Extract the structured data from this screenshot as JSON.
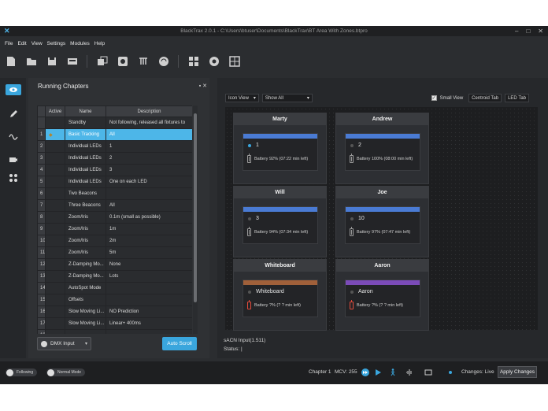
{
  "app": {
    "window_title": "BlackTrax 2.0.1 - C:\\Users\\btuser\\Documents\\BlackTrax\\BT Area With Zones.btpro"
  },
  "menu": [
    "File",
    "Edit",
    "View",
    "Settings",
    "Modules",
    "Help"
  ],
  "toolbar_icons": [
    "new-file-icon",
    "open-folder-icon",
    "save-icon",
    "save-as-icon",
    "clone-icon",
    "sync-icon",
    "trackers-icon",
    "wifi-icon",
    "layout-icon",
    "target-icon",
    "grid-icon"
  ],
  "rail_icons": [
    "eye-icon",
    "pencil-icon",
    "wave-icon",
    "camera-icon",
    "network-icon"
  ],
  "chapters": {
    "title": "Running Chapters",
    "columns": {
      "active": "Active",
      "name": "Name",
      "description": "Description"
    },
    "rows": [
      {
        "num": "",
        "name": "Standby",
        "description": "Not following, released all fixtures to"
      },
      {
        "num": "1",
        "name": "Basic Tracking",
        "description": "All",
        "selected": true
      },
      {
        "num": "2",
        "name": "Individual LEDs",
        "description": "1"
      },
      {
        "num": "3",
        "name": "Individual LEDs",
        "description": "2"
      },
      {
        "num": "4",
        "name": "Individual LEDs",
        "description": "3"
      },
      {
        "num": "5",
        "name": "Individual LEDs",
        "description": "One on each LED"
      },
      {
        "num": "6",
        "name": "Two Beacons",
        "description": ""
      },
      {
        "num": "7",
        "name": "Three Beacons",
        "description": "All"
      },
      {
        "num": "8",
        "name": "Zoom/Iris",
        "description": "0.1m (small as possible)"
      },
      {
        "num": "9",
        "name": "Zoom/Iris",
        "description": "1m"
      },
      {
        "num": "10",
        "name": "Zoom/Iris",
        "description": "2m"
      },
      {
        "num": "11",
        "name": "Zoom/Iris",
        "description": "5m"
      },
      {
        "num": "12",
        "name": "Z-Damping Mo...",
        "description": "None"
      },
      {
        "num": "13",
        "name": "Z-Damping Mo...",
        "description": "Lots"
      },
      {
        "num": "14",
        "name": "AutoSpot Mode",
        "description": ""
      },
      {
        "num": "15",
        "name": "Offsets",
        "description": ""
      },
      {
        "num": "16",
        "name": "Slow Moving Li...",
        "description": "NO Prediction"
      },
      {
        "num": "17",
        "name": "Slow Moving Li...",
        "description": "Linear+ 400ms"
      },
      {
        "num": "18",
        "name": "",
        "description": ""
      }
    ],
    "input_select": "DMX Input",
    "auto_scroll": "Auto Scroll"
  },
  "view": {
    "view_mode": "Icon View",
    "filter": "Show All",
    "small_view_label": "Small View",
    "small_view_checked": true,
    "centroid_tab": "Centroid Tab",
    "led_tab": "LED Tab"
  },
  "trackers": [
    {
      "name": "Marty",
      "id": "1",
      "battery": "Battery 92% (07:22 min left)",
      "level": 0.92,
      "color": "#4a7bd4",
      "low": false,
      "active": true
    },
    {
      "name": "Andrew",
      "id": "2",
      "battery": "Battery 100% (08:00 min left)",
      "level": 1.0,
      "color": "#4a7bd4",
      "low": false,
      "active": false
    },
    {
      "name": "Will",
      "id": "3",
      "battery": "Battery 94% (07:34 min left)",
      "level": 0.94,
      "color": "#4a7bd4",
      "low": false,
      "active": false
    },
    {
      "name": "Joe",
      "id": "10",
      "battery": "Battery 97% (07:47 min left)",
      "level": 0.97,
      "color": "#4a7bd4",
      "low": false,
      "active": false
    },
    {
      "name": "Whiteboard",
      "id": "Whiteboard",
      "battery": "Battery ?% (? ? min left)",
      "level": 0.0,
      "color": "#a0603a",
      "low": true,
      "active": false
    },
    {
      "name": "Aaron",
      "id": "Aaron",
      "battery": "Battery ?% (? ? min left)",
      "level": 0.0,
      "color": "#7b4bb8",
      "low": true,
      "active": false
    }
  ],
  "info": {
    "sacn": "sACN Input(1.511)",
    "status": "Status: |"
  },
  "bottom": {
    "following": "Following",
    "normal_mode": "Normal Mode",
    "chapter": "Chapter 1",
    "mcv": "MCV: 255",
    "changes": "Changes: Live",
    "apply": "Apply Changes"
  },
  "colors": {
    "accent": "#3aa6dd",
    "background": "#2b2d30",
    "battery_low": "#e24a3b"
  }
}
